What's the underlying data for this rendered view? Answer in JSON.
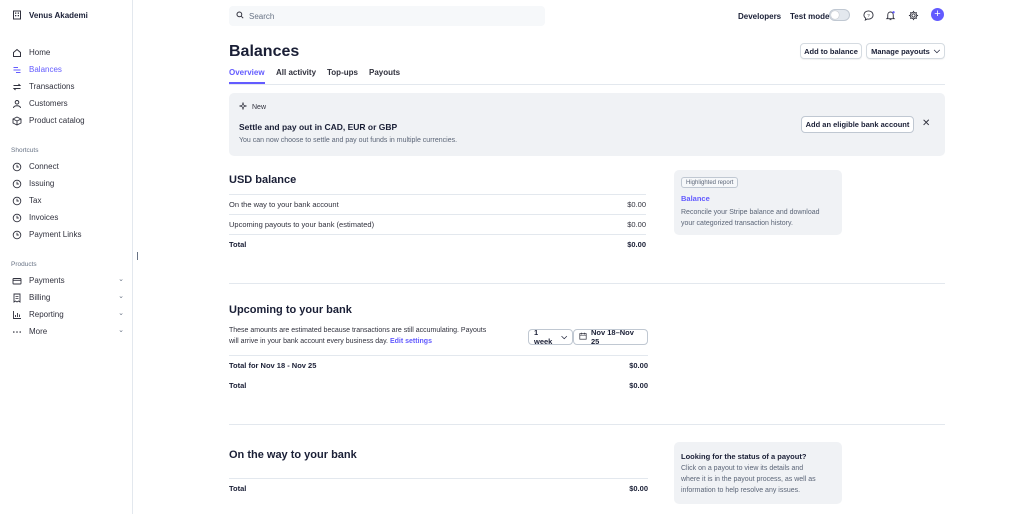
{
  "brand": {
    "name": "Venus Akademi"
  },
  "sidebar": {
    "items": [
      {
        "label": "Home",
        "icon": "home-icon"
      },
      {
        "label": "Balances",
        "icon": "balances-icon",
        "active": true
      },
      {
        "label": "Transactions",
        "icon": "transactions-icon"
      },
      {
        "label": "Customers",
        "icon": "customers-icon"
      },
      {
        "label": "Product catalog",
        "icon": "product-catalog-icon"
      }
    ],
    "shortcuts_label": "Shortcuts",
    "shortcuts": [
      {
        "label": "Connect",
        "icon": "clock-icon"
      },
      {
        "label": "Issuing",
        "icon": "clock-icon"
      },
      {
        "label": "Tax",
        "icon": "clock-icon"
      },
      {
        "label": "Invoices",
        "icon": "clock-icon"
      },
      {
        "label": "Payment Links",
        "icon": "clock-icon"
      }
    ],
    "products_label": "Products",
    "products": [
      {
        "label": "Payments",
        "icon": "payments-icon"
      },
      {
        "label": "Billing",
        "icon": "billing-icon"
      },
      {
        "label": "Reporting",
        "icon": "reporting-icon"
      },
      {
        "label": "More",
        "icon": "more-icon"
      }
    ]
  },
  "topbar": {
    "search_placeholder": "Search",
    "developers": "Developers",
    "test_mode": "Test mode"
  },
  "header": {
    "title": "Balances",
    "add_to_balance": "Add to balance",
    "manage_payouts": "Manage payouts",
    "tabs": [
      "Overview",
      "All activity",
      "Top-ups",
      "Payouts"
    ]
  },
  "banner": {
    "tag": "New",
    "title": "Settle and pay out in CAD, EUR or GBP",
    "description": "You can now choose to settle and pay out funds in multiple currencies.",
    "button": "Add an eligible bank account"
  },
  "usd_balance": {
    "title": "USD balance",
    "rows": [
      {
        "label": "On the way to your bank account",
        "value": "$0.00"
      },
      {
        "label": "Upcoming payouts to your bank (estimated)",
        "value": "$0.00"
      },
      {
        "label": "Total",
        "value": "$0.00"
      }
    ]
  },
  "highlight_card": {
    "pill": "Highlighted report",
    "link": "Balance",
    "text_line1": "Reconcile your Stripe balance and download",
    "text_line2": "your categorized transaction history."
  },
  "upcoming": {
    "title": "Upcoming to your bank",
    "desc_line1": "These amounts are estimated because transactions are still accumulating. Payouts",
    "desc_line2": "will arrive in your bank account every business day.",
    "edit_settings": "Edit settings",
    "period": "1 week",
    "date_range": "Nov 18–Nov 25",
    "rows": [
      {
        "label": "Total for Nov 18 - Nov 25",
        "value": "$0.00"
      },
      {
        "label": "Total",
        "value": "$0.00"
      }
    ]
  },
  "on_the_way": {
    "title": "On the way to your bank",
    "rows": [
      {
        "label": "Total",
        "value": "$0.00"
      }
    ]
  },
  "status_card": {
    "title": "Looking for the status of a payout?",
    "line1": "Click on a payout to view its details and",
    "line2": "where it is in the payout process, as well as",
    "line3": "information to help resolve any issues."
  },
  "colors": {
    "accent": "#635bff",
    "text": "#1a1f36",
    "muted": "#687385"
  }
}
